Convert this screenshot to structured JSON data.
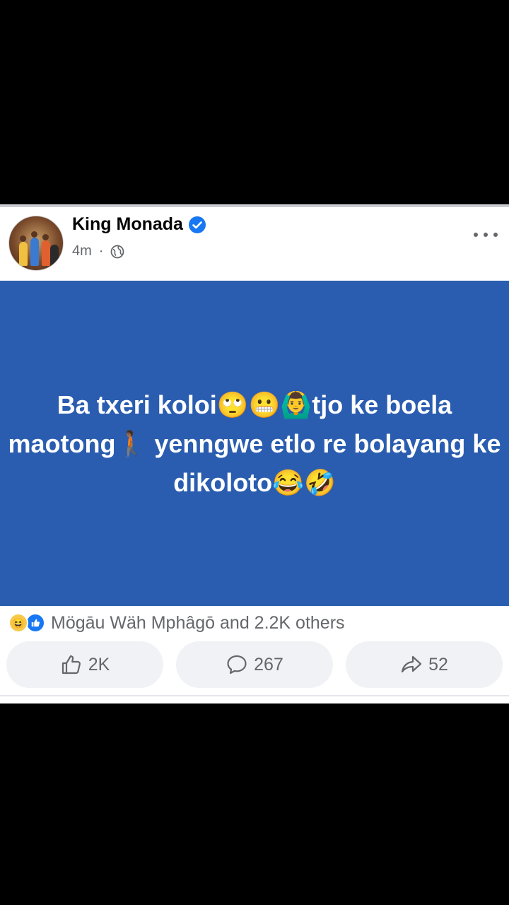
{
  "post": {
    "author": "King Monada",
    "time": "4m",
    "separator": "·",
    "banner_text": "Ba txeri koloi🙄😬🙆‍♂️tjo ke boela maotong🚶🏾 yenngwe etlo re bolayang ke dikoloto😂🤣",
    "reactions_text": "Mögāu Wäh Mphâgō and 2.2K others",
    "reaction_icons": [
      "haha-icon",
      "like-icon"
    ],
    "like_count": "2K",
    "comment_count": "267",
    "share_count": "52"
  },
  "colors": {
    "banner": "#2a5db0",
    "verified": "#1877f2",
    "secondary_text": "#65676b",
    "action_bg": "#f0f2f5"
  }
}
